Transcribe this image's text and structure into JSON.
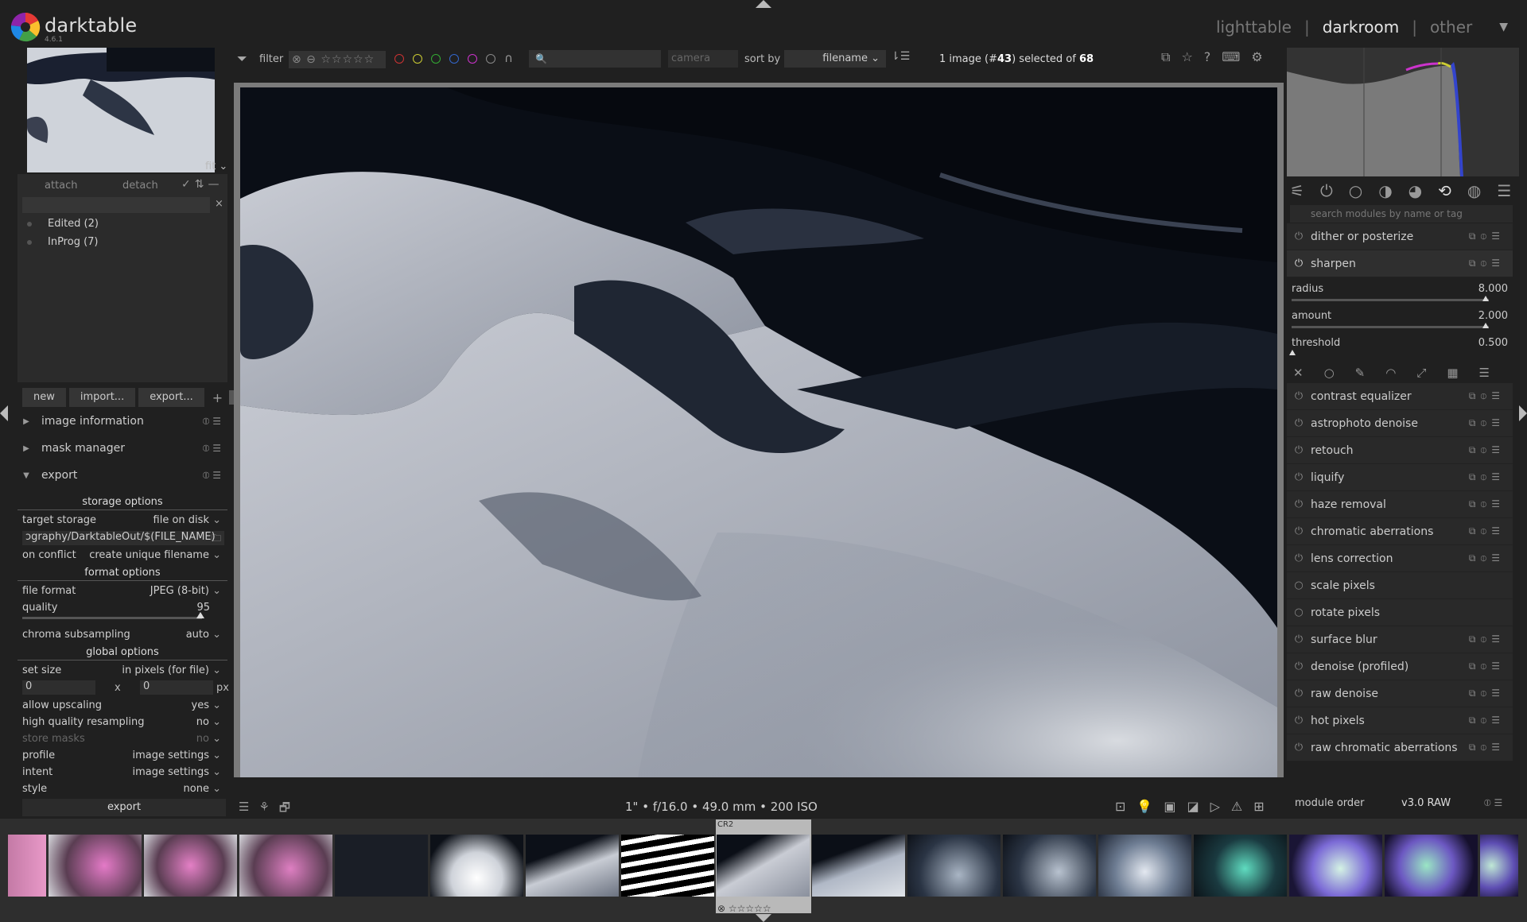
{
  "app": {
    "name": "darktable",
    "version": "4.6.1"
  },
  "views": {
    "lighttable": "lighttable",
    "darkroom": "darkroom",
    "other": "other",
    "sep": "|"
  },
  "navigation": {
    "zoom": "fit"
  },
  "collections": {
    "attach": "attach",
    "detach": "detach",
    "items": [
      {
        "label": "Edited (2)"
      },
      {
        "label": "InProg (7)"
      }
    ]
  },
  "collections_toolbar": {
    "new": "new",
    "import": "import...",
    "export": "export..."
  },
  "left_modules": {
    "image_information": "image information",
    "mask_manager": "mask manager",
    "export": "export"
  },
  "export": {
    "storage_options": "storage options",
    "target_storage_label": "target storage",
    "target_storage": "file on disk",
    "path": "ɔgraphy/DarktableOut/$(FILE_NAME)",
    "on_conflict_label": "on conflict",
    "on_conflict": "create unique filename",
    "format_options": "format options",
    "file_format_label": "file format",
    "file_format": "JPEG (8-bit)",
    "quality_label": "quality",
    "quality": "95",
    "chroma_label": "chroma subsampling",
    "chroma": "auto",
    "global_options": "global options",
    "set_size_label": "set size",
    "set_size": "in pixels (for file)",
    "width": "0",
    "x": "x",
    "height": "0",
    "px": "px",
    "upscaling_label": "allow upscaling",
    "upscaling": "yes",
    "hq_label": "high quality resampling",
    "hq": "no",
    "store_masks_label": "store masks",
    "store_masks": "no",
    "profile_label": "profile",
    "profile": "image settings",
    "intent_label": "intent",
    "intent": "image settings",
    "style_label": "style",
    "style": "none",
    "button": "export"
  },
  "filterbar": {
    "filter": "filter",
    "camera": "camera",
    "sort_by": "sort by",
    "sort_value": "filename",
    "selection_pre": "1 image (#",
    "selection_num": "43",
    "selection_mid": ") selected of ",
    "selection_total": "68"
  },
  "image_info": {
    "exposure": "1\" • f/16.0 • 49.0 mm • 200 ISO"
  },
  "filmstrip": {
    "format": "CR2"
  },
  "right": {
    "search_placeholder": "search modules by name or tag",
    "modules_top": [
      {
        "label": "dither or posterize"
      },
      {
        "label": "sharpen"
      }
    ],
    "sharpen": {
      "radius_label": "radius",
      "radius": "8.000",
      "amount_label": "amount",
      "amount": "2.000",
      "threshold_label": "threshold",
      "threshold": "0.500"
    },
    "modules": [
      {
        "label": "contrast equalizer"
      },
      {
        "label": "astrophoto denoise"
      },
      {
        "label": "retouch"
      },
      {
        "label": "liquify"
      },
      {
        "label": "haze removal"
      },
      {
        "label": "chromatic aberrations"
      },
      {
        "label": "lens correction"
      },
      {
        "label": "scale pixels"
      },
      {
        "label": "rotate pixels"
      },
      {
        "label": "surface blur"
      },
      {
        "label": "denoise (profiled)"
      },
      {
        "label": "raw denoise"
      },
      {
        "label": "hot pixels"
      },
      {
        "label": "raw chromatic aberrations"
      }
    ],
    "module_order_label": "module order",
    "module_order": "v3.0 RAW"
  },
  "colors": {
    "bg": "#202020",
    "panel": "#292929",
    "accent": "#cfcfcf"
  }
}
